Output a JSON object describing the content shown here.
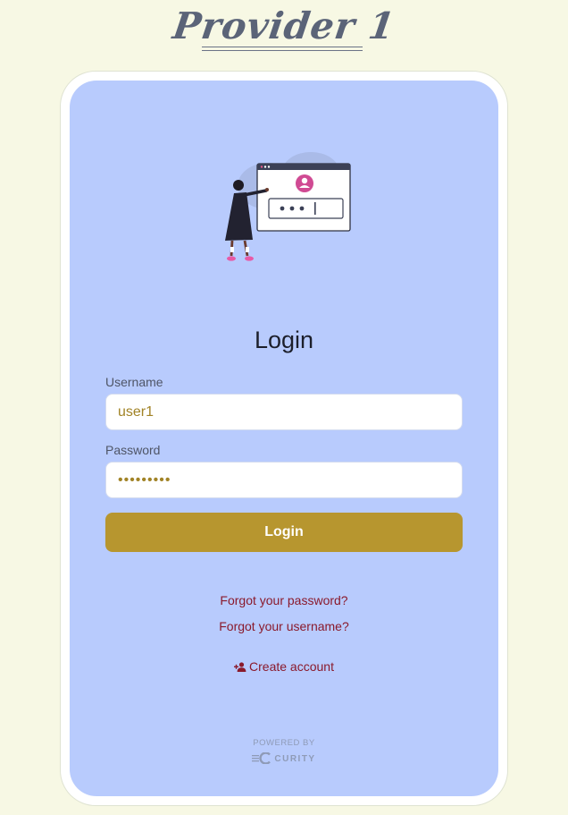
{
  "brand": {
    "title": "Provider 1"
  },
  "login": {
    "heading": "Login",
    "username_label": "Username",
    "username_value": "user1",
    "password_label": "Password",
    "password_value": "•••••••••",
    "submit_label": "Login"
  },
  "links": {
    "forgot_password": "Forgot your password?",
    "forgot_username": "Forgot your username?",
    "create_account": "Create account"
  },
  "footer": {
    "powered_by": "POWERED BY",
    "vendor": "CURITY"
  },
  "icons": {
    "illustration": "login-illustration",
    "create_account": "add-user-icon",
    "vendor_logo": "curity-logo-icon"
  },
  "colors": {
    "page_bg": "#f7f8e4",
    "card_bg": "#b8cbfd",
    "button_bg": "#b7962f",
    "link": "#8a1a2c",
    "input_text": "#a18326"
  }
}
